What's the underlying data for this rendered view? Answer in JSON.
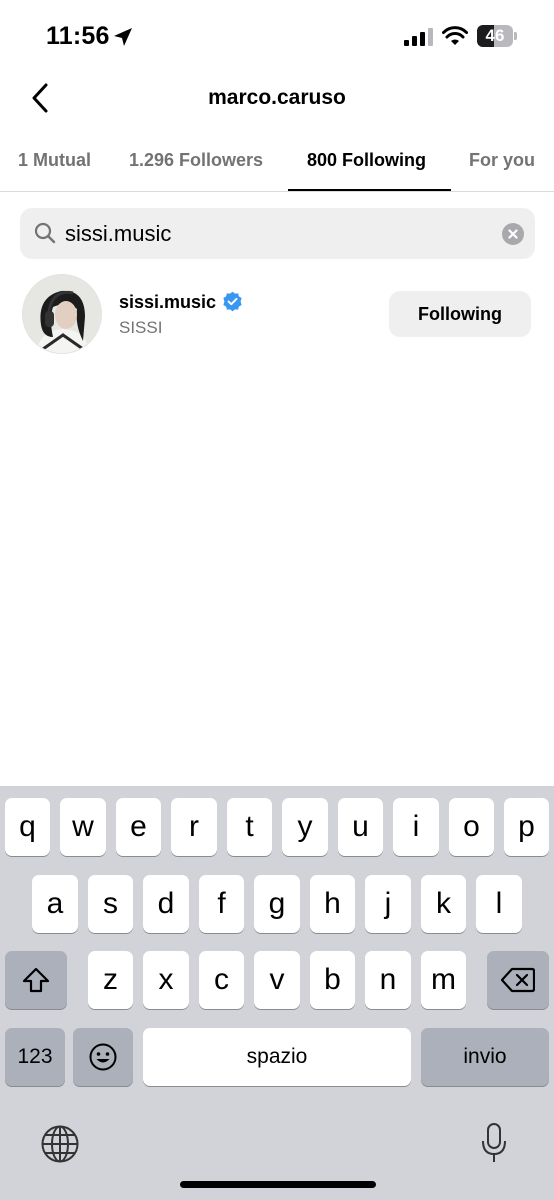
{
  "status_bar": {
    "time": "11:56",
    "battery_level": "46",
    "battery_fraction": 0.46,
    "icons": [
      "location-arrow-icon",
      "cellular-signal-icon",
      "wifi-icon",
      "battery-icon"
    ]
  },
  "header": {
    "title": "marco.caruso",
    "back_icon": "chevron-left-icon"
  },
  "tabs": [
    {
      "label": "1 Mutual",
      "active": false
    },
    {
      "label": "1.296 Followers",
      "active": false
    },
    {
      "label": "800 Following",
      "active": true
    },
    {
      "label": "For you",
      "active": false
    }
  ],
  "search": {
    "value": "sissi.music",
    "icon": "search-icon",
    "clear_icon": "clear-circle-icon"
  },
  "results": [
    {
      "username": "sissi.music",
      "full_name": "SISSI",
      "verified": true,
      "button_label": "Following"
    }
  ],
  "keyboard": {
    "row1": [
      "q",
      "w",
      "e",
      "r",
      "t",
      "y",
      "u",
      "i",
      "o",
      "p"
    ],
    "row2": [
      "a",
      "s",
      "d",
      "f",
      "g",
      "h",
      "j",
      "k",
      "l"
    ],
    "row3": [
      "z",
      "x",
      "c",
      "v",
      "b",
      "n",
      "m"
    ],
    "numbers_label": "123",
    "space_label": "spazio",
    "return_label": "invio",
    "icons": [
      "shift-icon",
      "backspace-icon",
      "emoji-icon",
      "globe-icon",
      "microphone-icon"
    ]
  },
  "colors": {
    "accent_verified": "#3897f0",
    "keyboard_bg": "#d1d3d9",
    "secondary_text": "#737373"
  }
}
